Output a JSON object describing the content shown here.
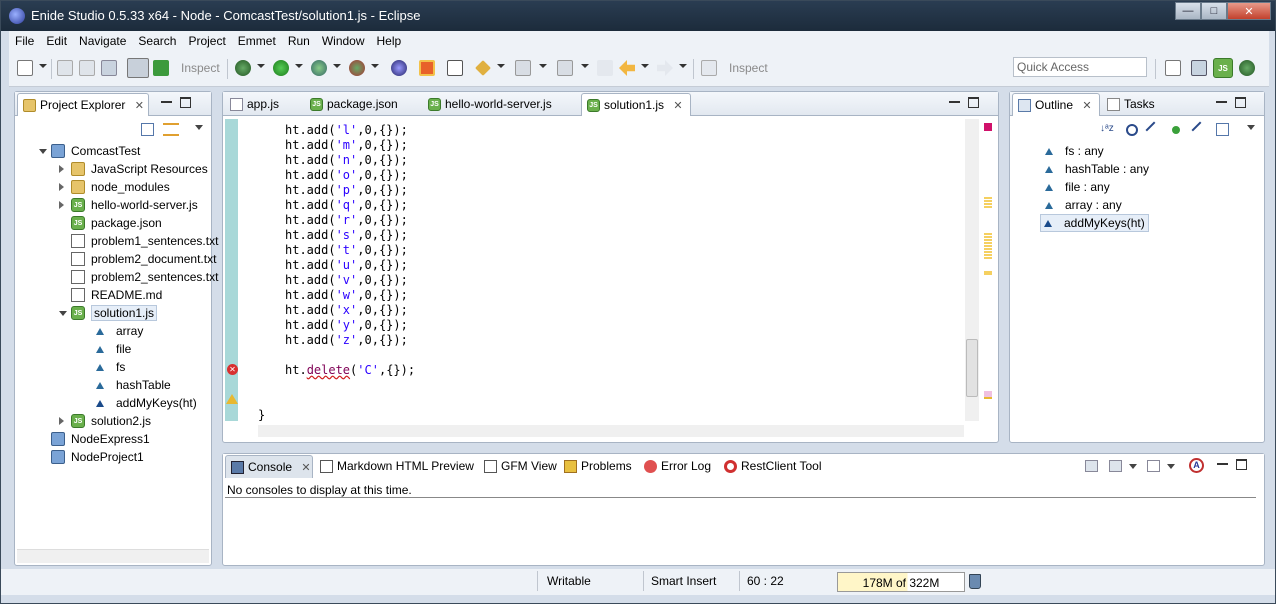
{
  "window": {
    "title": "Enide Studio 0.5.33 x64 - Node - ComcastTest/solution1.js - Eclipse",
    "minimize": "—",
    "maximize": "□",
    "close": "✕"
  },
  "menu": [
    "File",
    "Edit",
    "Navigate",
    "Search",
    "Project",
    "Emmet",
    "Run",
    "Window",
    "Help"
  ],
  "toolbar": {
    "inspect_label_1": "Inspect",
    "inspect_label_2": "Inspect",
    "quick_access_placeholder": "Quick Access"
  },
  "project_explorer": {
    "tab_label": "Project Explorer",
    "close": "✕",
    "tree": [
      {
        "label": "ComcastTest",
        "icon": "project-icon",
        "expanded": true
      },
      {
        "label": "JavaScript Resources",
        "icon": "js-resources-icon"
      },
      {
        "label": "node_modules",
        "icon": "folder-icon"
      },
      {
        "label": "hello-world-server.js",
        "icon": "js-file-icon"
      },
      {
        "label": "package.json",
        "icon": "js-file-icon"
      },
      {
        "label": "problem1_sentences.txt",
        "icon": "text-file-icon"
      },
      {
        "label": "problem2_document.txt",
        "icon": "text-file-icon"
      },
      {
        "label": "problem2_sentences.txt",
        "icon": "text-file-icon"
      },
      {
        "label": "README.md",
        "icon": "text-file-icon"
      },
      {
        "label": "solution1.js",
        "icon": "js-file-icon",
        "expanded": true
      },
      {
        "label": "array",
        "icon": "field-icon"
      },
      {
        "label": "file",
        "icon": "field-icon"
      },
      {
        "label": "fs",
        "icon": "field-icon"
      },
      {
        "label": "hashTable",
        "icon": "field-icon"
      },
      {
        "label": "addMyKeys(ht)",
        "icon": "function-icon"
      },
      {
        "label": "solution2.js",
        "icon": "js-file-icon"
      },
      {
        "label": "NodeExpress1",
        "icon": "project-folder-icon"
      },
      {
        "label": "NodeProject1",
        "icon": "project-folder-icon"
      }
    ]
  },
  "editor": {
    "tabs": [
      {
        "label": "app.js",
        "active": false
      },
      {
        "label": "package.json",
        "active": false
      },
      {
        "label": "hello-world-server.js",
        "active": false
      },
      {
        "label": "solution1.js",
        "active": true,
        "close": "✕"
      }
    ],
    "code_lines": [
      {
        "prefix": "ht.add(",
        "arg": "'l'",
        "suffix": ",0,{});"
      },
      {
        "prefix": "ht.add(",
        "arg": "'m'",
        "suffix": ",0,{});"
      },
      {
        "prefix": "ht.add(",
        "arg": "'n'",
        "suffix": ",0,{});"
      },
      {
        "prefix": "ht.add(",
        "arg": "'o'",
        "suffix": ",0,{});"
      },
      {
        "prefix": "ht.add(",
        "arg": "'p'",
        "suffix": ",0,{});"
      },
      {
        "prefix": "ht.add(",
        "arg": "'q'",
        "suffix": ",0,{});"
      },
      {
        "prefix": "ht.add(",
        "arg": "'r'",
        "suffix": ",0,{});"
      },
      {
        "prefix": "ht.add(",
        "arg": "'s'",
        "suffix": ",0,{});"
      },
      {
        "prefix": "ht.add(",
        "arg": "'t'",
        "suffix": ",0,{});"
      },
      {
        "prefix": "ht.add(",
        "arg": "'u'",
        "suffix": ",0,{});"
      },
      {
        "prefix": "ht.add(",
        "arg": "'v'",
        "suffix": ",0,{});"
      },
      {
        "prefix": "ht.add(",
        "arg": "'w'",
        "suffix": ",0,{});"
      },
      {
        "prefix": "ht.add(",
        "arg": "'x'",
        "suffix": ",0,{});"
      },
      {
        "prefix": "ht.add(",
        "arg": "'y'",
        "suffix": ",0,{});"
      },
      {
        "prefix": "ht.add(",
        "arg": "'z'",
        "suffix": ",0,{});"
      }
    ],
    "delete_line": {
      "obj": "ht.",
      "method": "delete",
      "open": "(",
      "arg": "'C'",
      "rest": ",{});"
    },
    "closing_brace": "}"
  },
  "outline": {
    "tab_label": "Outline",
    "tasks_label": "Tasks",
    "close": "✕",
    "items": [
      {
        "label": "fs : any",
        "icon": "field-icon"
      },
      {
        "label": "hashTable : any",
        "icon": "field-icon"
      },
      {
        "label": "file : any",
        "icon": "field-icon"
      },
      {
        "label": "array : any",
        "icon": "field-icon"
      },
      {
        "label": "addMyKeys(ht)",
        "icon": "function-icon",
        "selected": true
      }
    ]
  },
  "console": {
    "tabs": [
      {
        "label": "Console",
        "active": true,
        "close": "✕"
      },
      {
        "label": "Markdown HTML Preview"
      },
      {
        "label": "GFM View"
      },
      {
        "label": "Problems"
      },
      {
        "label": "Error Log"
      },
      {
        "label": "RestClient Tool"
      }
    ],
    "message": "No consoles to display at this time."
  },
  "status": {
    "writable": "Writable",
    "insert_mode": "Smart Insert",
    "position": "60 : 22",
    "memory": "178M of 322M",
    "memory_used_fraction": 0.55
  }
}
